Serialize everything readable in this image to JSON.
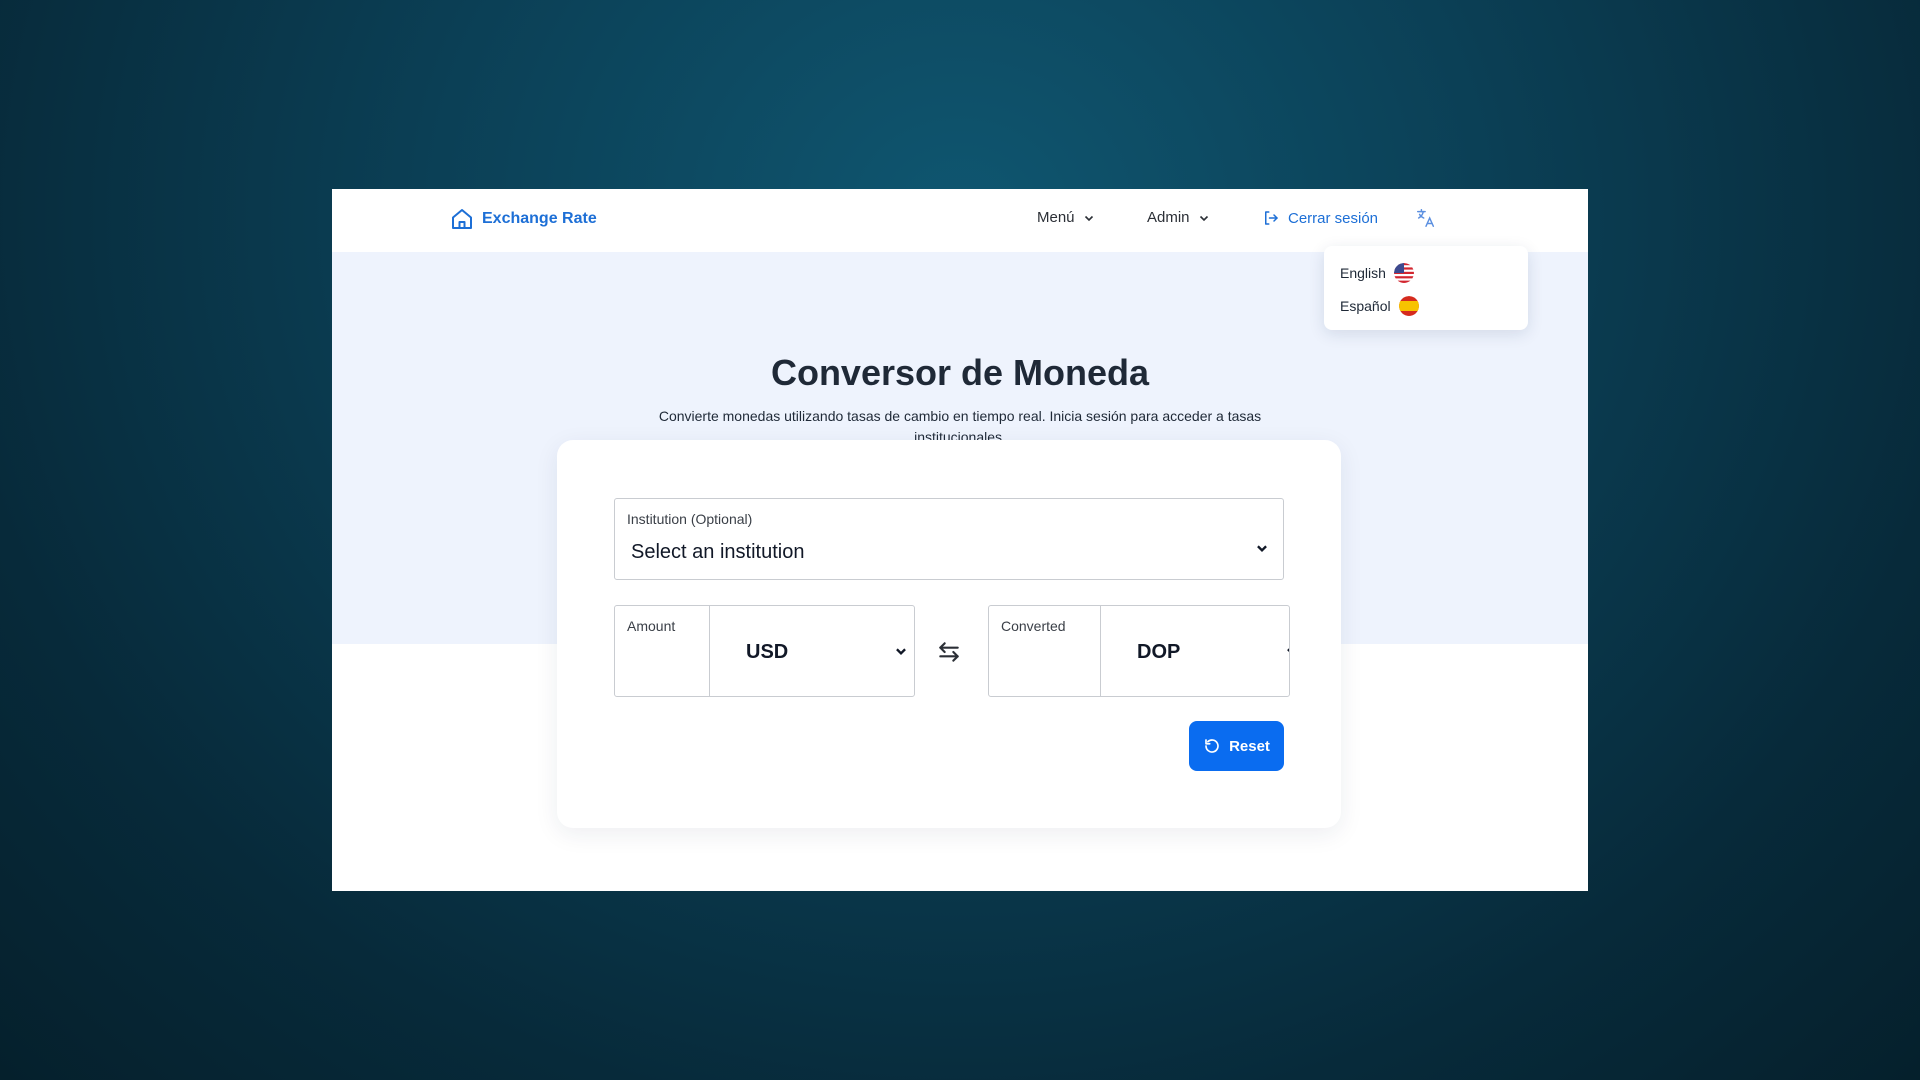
{
  "navbar": {
    "brand": "Exchange Rate",
    "menu_label": "Menú",
    "admin_label": "Admin",
    "logout_label": "Cerrar sesión",
    "language_icon": "translate-icon"
  },
  "language_menu": {
    "options": [
      {
        "label": "English",
        "flag": "us-flag-icon"
      },
      {
        "label": "Español",
        "flag": "spain-flag-icon"
      }
    ]
  },
  "hero": {
    "title": "Conversor de Moneda",
    "subtitle": "Convierte monedas utilizando tasas de cambio en tiempo real. Inicia sesión para acceder a tasas institucionales."
  },
  "converter": {
    "institution_label": "Institution (Optional)",
    "institution_value": "Select an institution",
    "amount_label": "Amount",
    "from_currency": "USD",
    "converted_label": "Converted",
    "to_currency": "DOP",
    "reset_label": "Reset"
  },
  "colors": {
    "accent": "#0a6cf0",
    "brand": "#1d6fd6",
    "hero_bg": "#eef3fd"
  }
}
